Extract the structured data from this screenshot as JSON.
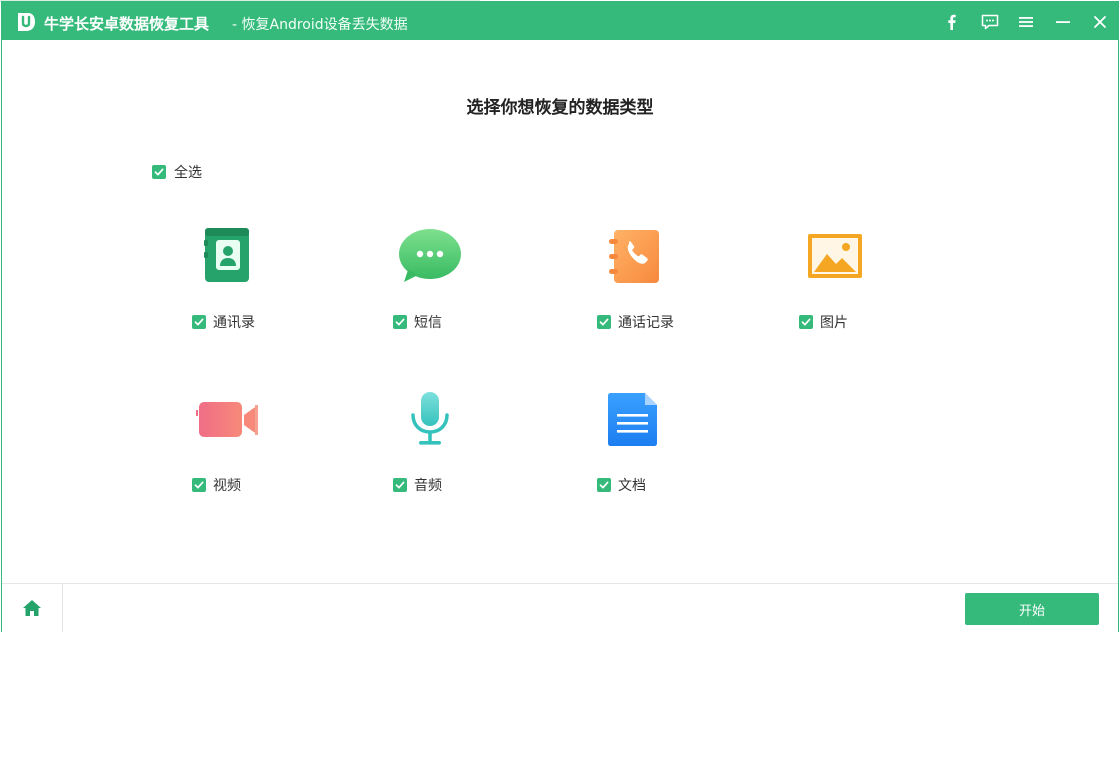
{
  "window": {
    "title": "牛学长安卓数据恢复工具",
    "subtitle": "- 恢复Android设备丢失数据"
  },
  "titlebar_buttons": [
    {
      "name": "facebook-icon"
    },
    {
      "name": "feedback-icon"
    },
    {
      "name": "menu-icon"
    },
    {
      "name": "minimize-icon"
    },
    {
      "name": "close-icon"
    }
  ],
  "main": {
    "heading": "选择你想恢复的数据类型",
    "select_all_label": "全选",
    "items": [
      {
        "label": "通讯录",
        "icon": "contacts-icon",
        "checked": true
      },
      {
        "label": "短信",
        "icon": "messages-icon",
        "checked": true
      },
      {
        "label": "通话记录",
        "icon": "call-log-icon",
        "checked": true
      },
      {
        "label": "图片",
        "icon": "photos-icon",
        "checked": true
      },
      {
        "label": "视频",
        "icon": "video-icon",
        "checked": true
      },
      {
        "label": "音频",
        "icon": "audio-icon",
        "checked": true
      },
      {
        "label": "文档",
        "icon": "document-icon",
        "checked": true
      }
    ]
  },
  "footer": {
    "start_label": "开始",
    "home_icon": "home-icon"
  },
  "colors": {
    "brand_green": "#35ba7b"
  }
}
